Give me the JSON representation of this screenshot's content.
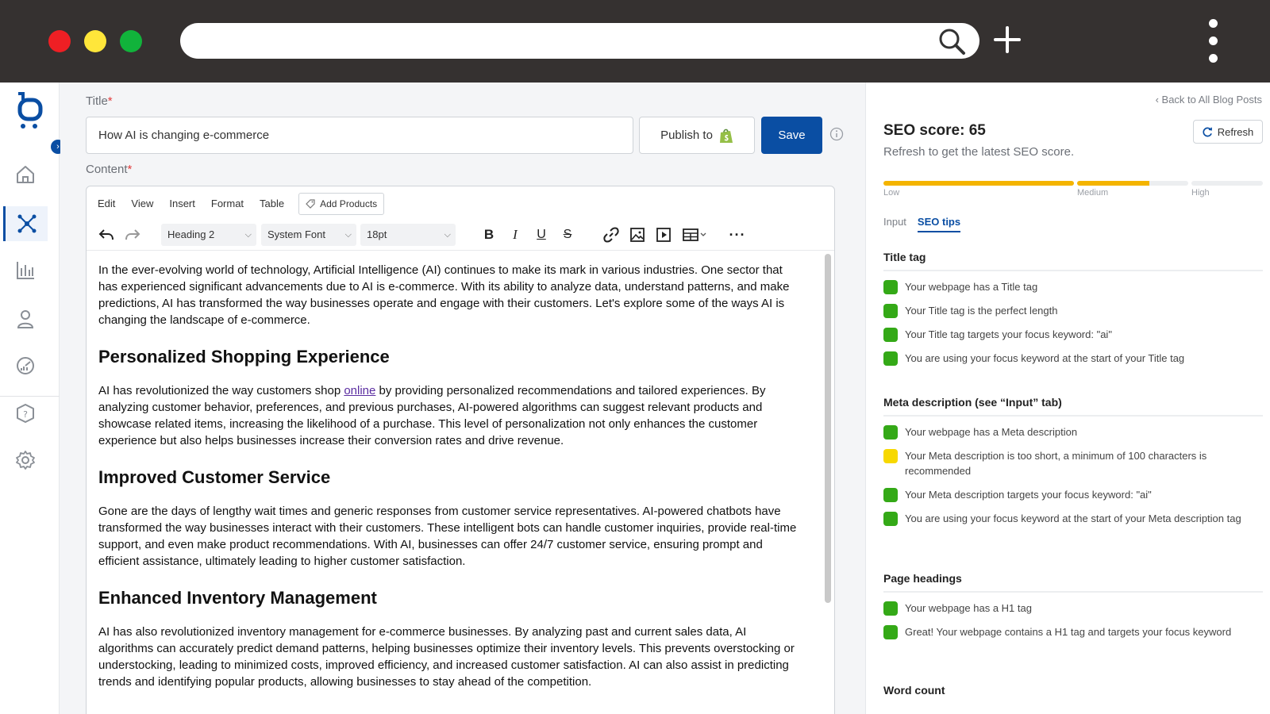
{
  "browser": {
    "url": "",
    "colors": {
      "chrome": "#353130",
      "close": "#ef1f24",
      "minimize": "#ffe63a",
      "maximize": "#11b33b"
    }
  },
  "nav": {
    "items": [
      {
        "name": "home",
        "icon": "home-icon",
        "active": false
      },
      {
        "name": "network",
        "icon": "network-icon",
        "active": true
      },
      {
        "name": "analytics",
        "icon": "bar-chart-icon",
        "active": false
      },
      {
        "name": "user",
        "icon": "user-icon",
        "active": false
      },
      {
        "name": "dashboard",
        "icon": "gauge-icon",
        "active": false
      },
      {
        "name": "help",
        "icon": "help-icon",
        "active": false
      },
      {
        "name": "settings",
        "icon": "gear-icon",
        "active": false
      }
    ]
  },
  "editor": {
    "title_label": "Title",
    "title_value": "How AI is changing e-commerce",
    "publish_label": "Publish to",
    "save_label": "Save",
    "content_label": "Content",
    "required_mark": "*",
    "menu": [
      "Edit",
      "View",
      "Insert",
      "Format",
      "Table"
    ],
    "add_products": "Add Products",
    "block_format": "Heading 2",
    "font_family": "System Font",
    "font_size": "18pt",
    "doc": {
      "p1": "In the ever-evolving world of technology, Artificial Intelligence (AI) continues to make its mark in various industries. One sector that has experienced significant advancements due to AI is e-commerce. With its ability to analyze data, understand patterns, and make predictions, AI has transformed the way businesses operate and engage with their customers. Let's explore some of the ways AI is changing the landscape of e-commerce.",
      "h1": "Personalized Shopping Experience",
      "p2_before": "AI has revolutionized the way customers shop ",
      "p2_link": "online",
      "p2_after": " by providing personalized recommendations and tailored experiences. By analyzing customer behavior, preferences, and previous purchases, AI-powered algorithms can suggest relevant products and showcase related items, increasing the likelihood of a purchase. This level of personalization not only enhances the customer experience but also helps businesses increase their conversion rates and drive revenue.",
      "h2": "Improved Customer Service",
      "p3": "Gone are the days of lengthy wait times and generic responses from customer service representatives. AI-powered chatbots have transformed the way businesses interact with their customers. These intelligent bots can handle customer inquiries, provide real-time support, and even make product recommendations. With AI, businesses can offer 24/7 customer service, ensuring prompt and efficient assistance, ultimately leading to higher customer satisfaction.",
      "h3": "Enhanced Inventory Management",
      "p4": "AI has also revolutionized inventory management for e-commerce businesses. By analyzing past and current sales data, AI algorithms can accurately predict demand patterns, helping businesses optimize their inventory levels. This prevents overstocking or understocking, leading to minimized costs, improved efficiency, and increased customer satisfaction. AI can also assist in predicting trends and identifying popular products, allowing businesses to stay ahead of the competition."
    }
  },
  "seo": {
    "back_link": "‹ Back to All Blog Posts",
    "score_title": "SEO score: 65",
    "score_value": 65,
    "subtitle": "Refresh to get the latest SEO score.",
    "refresh_label": "Refresh",
    "meter": {
      "labels": [
        "Low",
        "Medium",
        "High"
      ],
      "segment_fill": [
        1.0,
        0.65,
        0.0
      ],
      "color": "#f4b400"
    },
    "tabs": [
      "Input",
      "SEO tips"
    ],
    "active_tab": "SEO tips",
    "sections": [
      {
        "title": "Title tag",
        "tips": [
          {
            "status": "green",
            "text": "Your webpage has a Title tag"
          },
          {
            "status": "green",
            "text": "Your Title tag is the perfect length"
          },
          {
            "status": "green",
            "text": "Your Title tag targets your focus keyword: \"ai\""
          },
          {
            "status": "green",
            "text": "You are using your focus keyword at the start of your Title tag"
          }
        ]
      },
      {
        "title": "Meta description (see “Input” tab)",
        "tips": [
          {
            "status": "green",
            "text": "Your webpage has a Meta description"
          },
          {
            "status": "yellow",
            "text": "Your Meta description is too short, a minimum of 100 characters is recommended"
          },
          {
            "status": "green",
            "text": "Your Meta description targets your focus keyword: \"ai\""
          },
          {
            "status": "green",
            "text": "You are using your focus keyword at the start of your Meta description tag"
          }
        ]
      },
      {
        "title": "Page headings",
        "tips": [
          {
            "status": "green",
            "text": "Your webpage has a H1 tag"
          },
          {
            "status": "green",
            "text": "Great! Your webpage contains a H1 tag and targets your focus keyword"
          }
        ]
      },
      {
        "title": "Word count",
        "tips": []
      }
    ]
  }
}
